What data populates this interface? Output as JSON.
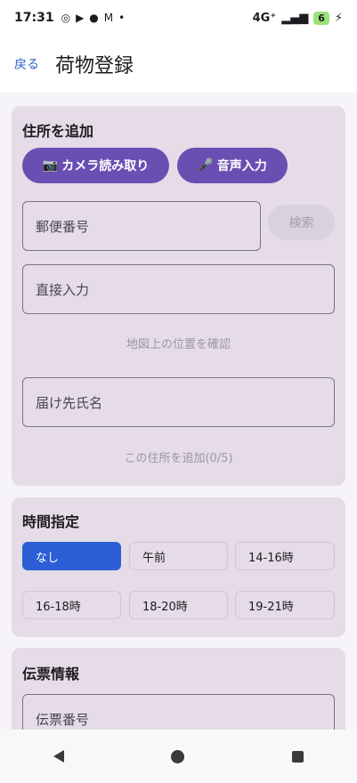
{
  "status": {
    "time": "17:31",
    "network": "4G⁺",
    "battery": "6"
  },
  "header": {
    "back_label": "戻る",
    "title": "荷物登録"
  },
  "address": {
    "title": "住所を追加",
    "camera_label": "カメラ読み取り",
    "voice_label": "音声入力",
    "postal_placeholder": "郵便番号",
    "search_label": "検索",
    "direct_placeholder": "直接入力",
    "map_hint": "地図上の位置を確認",
    "name_placeholder": "届け先氏名",
    "add_label": "この住所を追加(0/5)"
  },
  "time_slot": {
    "title": "時間指定",
    "options": [
      "なし",
      "午前",
      "14-16時",
      "16-18時",
      "18-20時",
      "19-21時"
    ],
    "selected": "なし"
  },
  "slip": {
    "title": "伝票情報",
    "number_placeholder": "伝票番号"
  },
  "colors": {
    "accent_purple": "#6a4fb3",
    "accent_blue": "#2c5fd6",
    "card_bg": "#e5dce8"
  }
}
